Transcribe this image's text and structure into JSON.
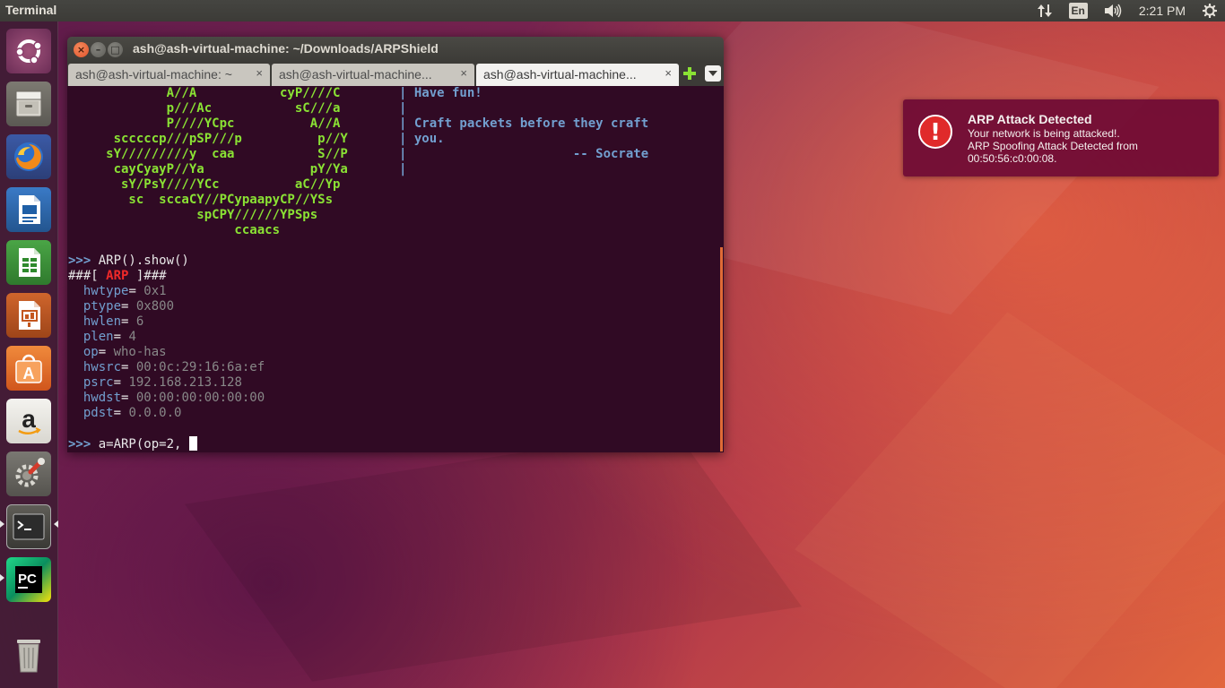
{
  "top_panel": {
    "app_title": "Terminal",
    "keyboard_layout": "En",
    "clock": "2:21 PM",
    "icons": [
      "network-updown-icon",
      "keyboard-layout-indicator",
      "volume-icon",
      "system-settings-gear-icon"
    ]
  },
  "launcher": {
    "items": [
      {
        "name": "ubuntu-dash-icon",
        "running": false
      },
      {
        "name": "files-icon",
        "running": false
      },
      {
        "name": "firefox-icon",
        "running": false
      },
      {
        "name": "libreoffice-writer-icon",
        "running": false
      },
      {
        "name": "libreoffice-calc-icon",
        "running": false
      },
      {
        "name": "libreoffice-impress-icon",
        "running": false
      },
      {
        "name": "software-center-icon",
        "running": false
      },
      {
        "name": "amazon-icon",
        "running": false
      },
      {
        "name": "system-settings-icon",
        "running": false
      },
      {
        "name": "terminal-icon",
        "running": true,
        "focused": true
      },
      {
        "name": "pycharm-icon",
        "running": true
      },
      {
        "name": "trash-icon",
        "running": false
      }
    ],
    "pycharm_label": "PC",
    "software_center_label": "A",
    "amazon_label": "a"
  },
  "window": {
    "title": "ash@ash-virtual-machine: ~/Downloads/ARPShield",
    "close_label": "×",
    "min_label": "–",
    "max_label": "□",
    "tabs": [
      {
        "label": "ash@ash-virtual-machine: ~",
        "active": false
      },
      {
        "label": "ash@ash-virtual-machine...",
        "active": false
      },
      {
        "label": "ash@ash-virtual-machine...",
        "active": true
      }
    ],
    "tab_close": "×"
  },
  "terminal": {
    "banner_art": [
      "             A//A           cyP////C   ",
      "             p///Ac           sC///a   ",
      "             P////YCpc          A//A   ",
      "      scccccp///pSP///p          p//Y  ",
      "     sY/////////y  caa           S//P  ",
      "      cayCyayP//Ya              pY/Ya  ",
      "       sY/PsY////YCc          aC//Yp   ",
      "        sc  sccaCY//PCypaapyCP//YSs    ",
      "                 spCPY//////YPSps      ",
      "                      ccaacs           "
    ],
    "banner_text": [
      "| Have fun!",
      "|",
      "| Craft packets before they craft",
      "| you.",
      "|                      -- Socrate",
      "|"
    ],
    "command_1": "ARP().show()",
    "prompt": ">>> ",
    "header_pre": "###[ ",
    "header_name": "ARP",
    "header_post": " ]###",
    "fields": [
      {
        "key": "hwtype",
        "value": "0x1"
      },
      {
        "key": "ptype",
        "value": "0x800"
      },
      {
        "key": "hwlen",
        "value": "6"
      },
      {
        "key": "plen",
        "value": "4"
      },
      {
        "key": "op",
        "value": "who-has"
      },
      {
        "key": "hwsrc",
        "value": "00:0c:29:16:6a:ef"
      },
      {
        "key": "psrc",
        "value": "192.168.213.128"
      },
      {
        "key": "hwdst",
        "value": "00:00:00:00:00:00"
      },
      {
        "key": "pdst",
        "value": "0.0.0.0"
      }
    ],
    "command_2": "a=ARP(op=2, "
  },
  "notification": {
    "title": "ARP Attack Detected",
    "body_lines": [
      "Your network is being attacked!.",
      "ARP Spoofing Attack Detected from",
      "00:50:56:c0:00:08."
    ],
    "icon_glyph": "!"
  },
  "colors": {
    "terminal_bg": "#300a24",
    "banner_green": "#8ae234",
    "banner_blue": "#729fcf",
    "arp_red": "#ef2929",
    "notification_bg": "#6e0a34",
    "accent_orange": "#e06b36"
  }
}
